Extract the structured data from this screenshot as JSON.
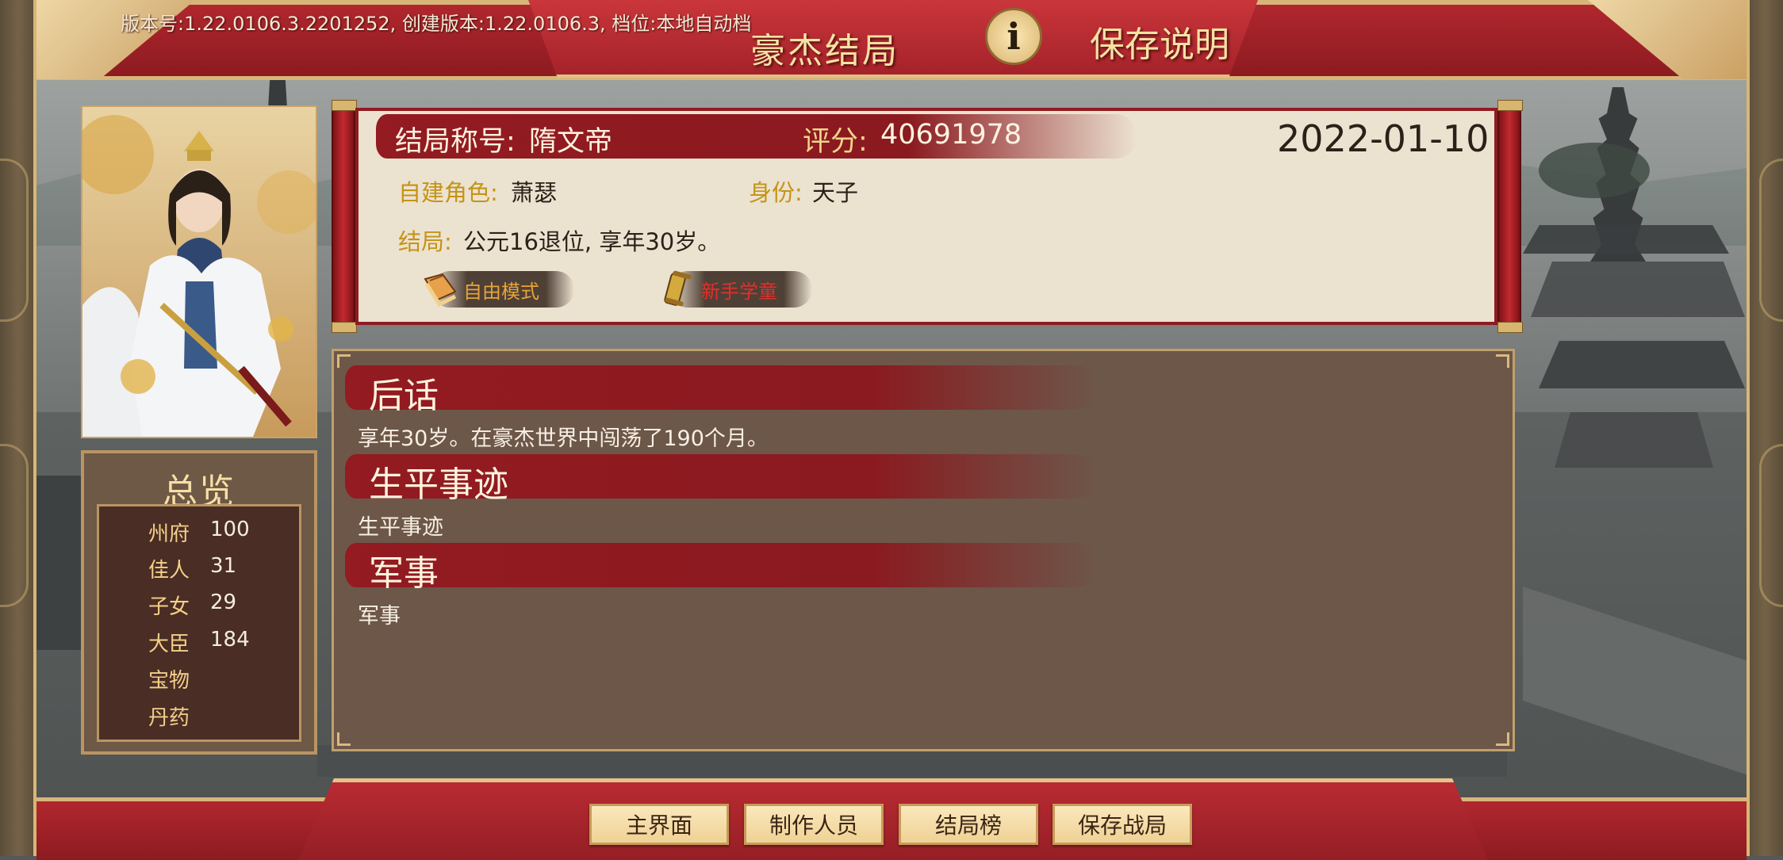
{
  "header": {
    "version_line": "版本号:1.22.0106.3.2201252, 创建版本:1.22.0106.3, 档位:本地自动档",
    "title": "豪杰结局",
    "info_icon_glyph": "i",
    "info_label": "保存说明",
    "info_icon": "info-icon"
  },
  "summary": {
    "ending_title_label": "结局称号:",
    "ending_title_value": "隋文帝",
    "score_label": "评分:",
    "score_value": "40691978",
    "date": "2022-01-10",
    "role_label": "自建角色:",
    "role_value": "萧瑟",
    "identity_label": "身份:",
    "identity_value": "天子",
    "ending_label": "结局:",
    "ending_value": "公元16退位, 享年30岁。",
    "tags": [
      {
        "label": "自由模式",
        "icon": "book-icon",
        "color": "#e8a33a"
      },
      {
        "label": "新手学童",
        "icon": "scroll-icon",
        "color": "#e0302c"
      }
    ]
  },
  "overview": {
    "title": "总览",
    "items": [
      {
        "label": "州府",
        "value": "100"
      },
      {
        "label": "佳人",
        "value": "31"
      },
      {
        "label": "子女",
        "value": "29"
      },
      {
        "label": "大臣",
        "value": "184"
      },
      {
        "label": "宝物",
        "value": ""
      },
      {
        "label": "丹药",
        "value": ""
      }
    ]
  },
  "content": {
    "sections": [
      {
        "title": "后话",
        "body": "享年30岁。在豪杰世界中闯荡了190个月。"
      },
      {
        "title": "生平事迹",
        "body": "生平事迹"
      },
      {
        "title": "军事",
        "body": "军事"
      }
    ]
  },
  "footer": {
    "buttons": [
      "主界面",
      "制作人员",
      "结局榜",
      "保存战局"
    ]
  },
  "colors": {
    "banner_red": "#a5222a",
    "gold_text": "#c49417",
    "panel_brown": "#6d5749",
    "button_cream": "#f5dfa8"
  }
}
